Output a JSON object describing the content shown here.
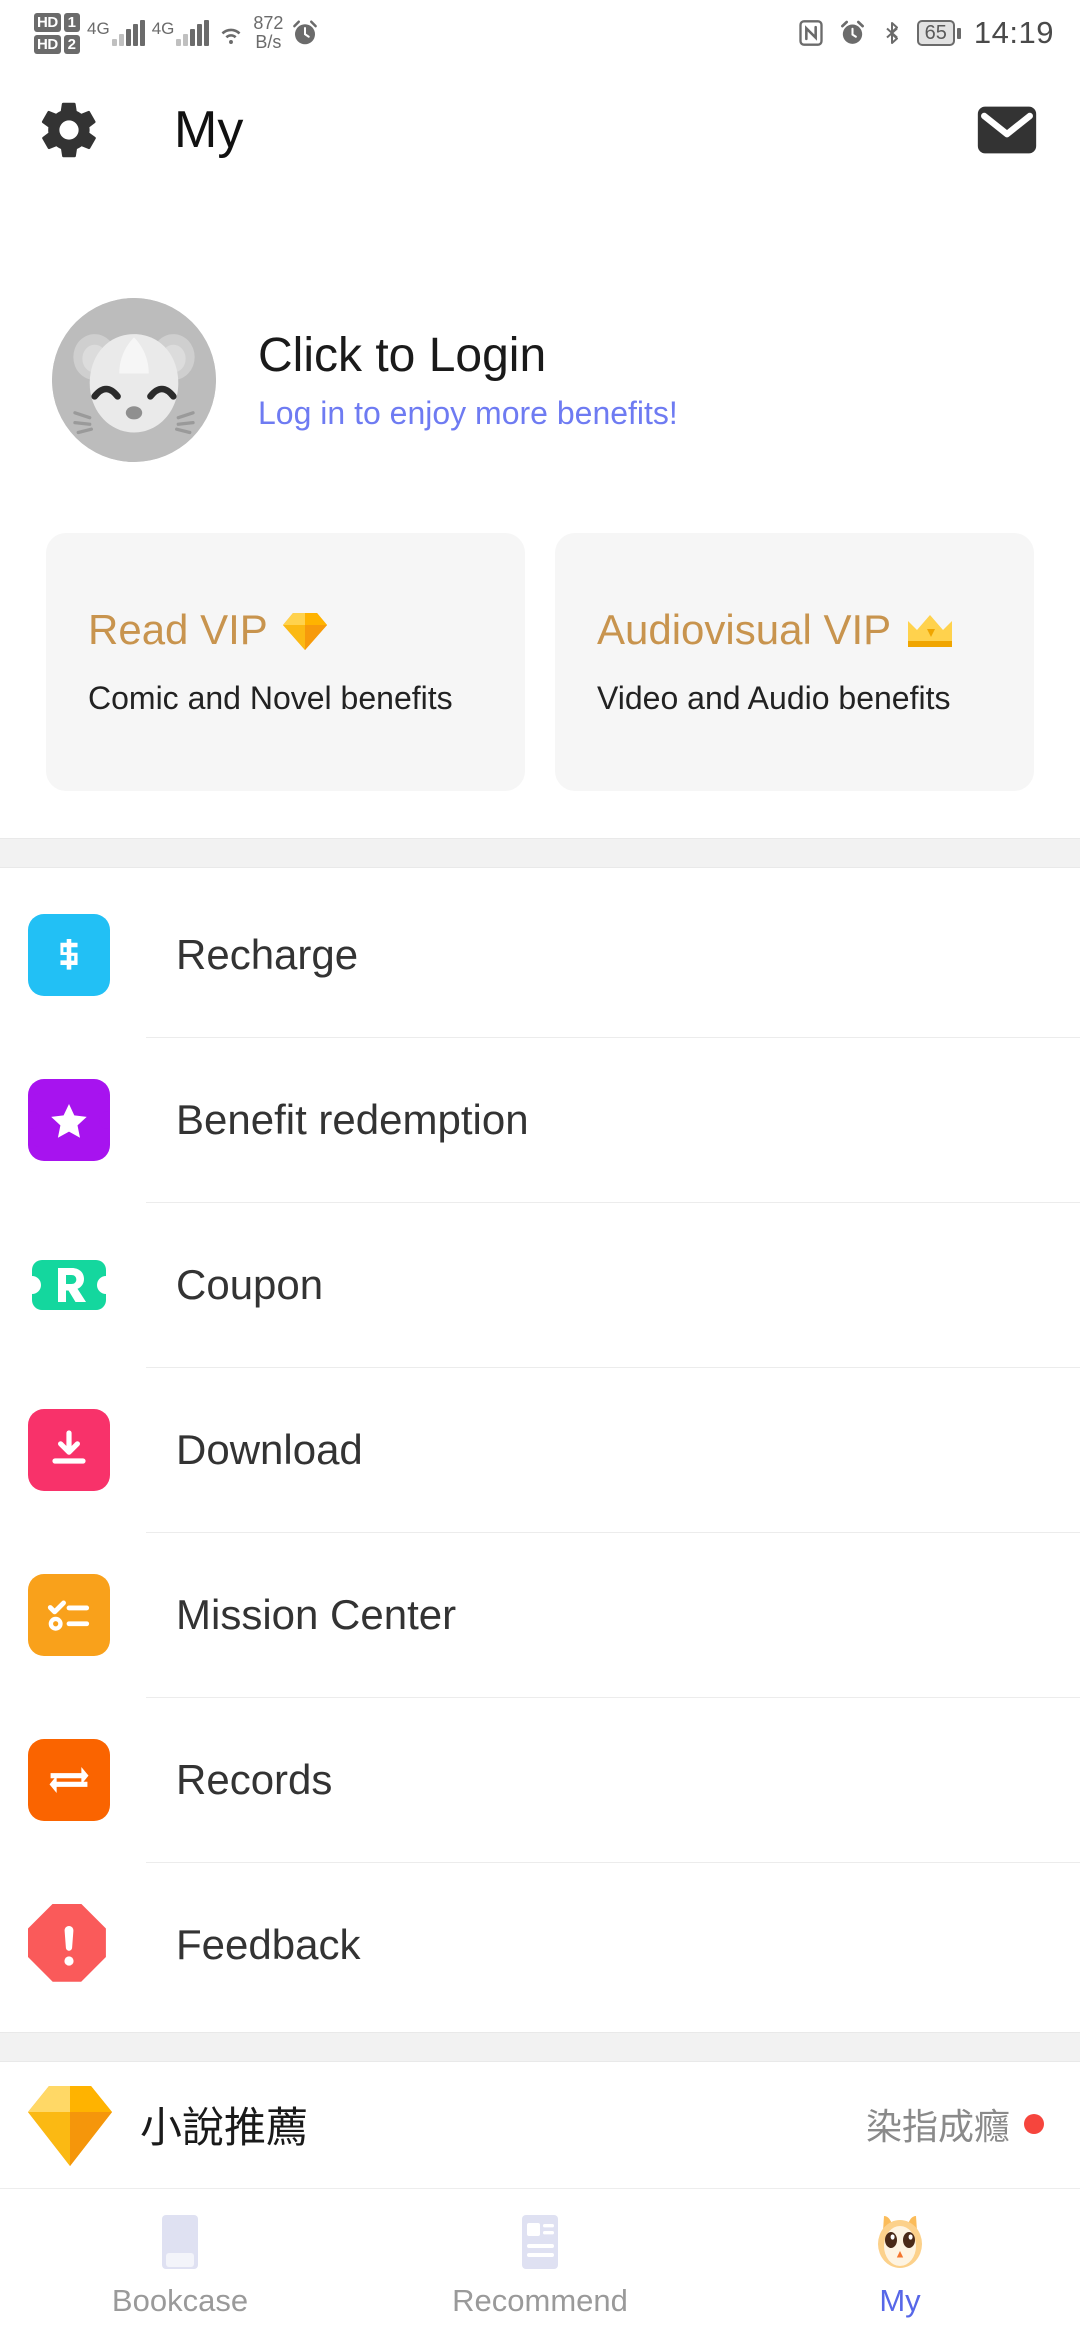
{
  "statusbar": {
    "hd_label_1": "HD",
    "hd_num_1": "1",
    "hd_label_2": "HD",
    "hd_num_2": "2",
    "sim1_network": "4G",
    "sim2_network": "4G",
    "netspeed_value": "872",
    "netspeed_unit": "B/s",
    "icons": [
      "nfc-icon",
      "alarm-icon",
      "bluetooth-icon"
    ],
    "battery_percent": "65",
    "time": "14:19"
  },
  "header": {
    "title": "My",
    "settings_icon": "gear-icon",
    "mail_icon": "mail-icon"
  },
  "profile": {
    "avatar_icon": "hamster-avatar",
    "title": "Click to Login",
    "subtitle": "Log in to enjoy more benefits!",
    "subtitle_color": "#6e7bf2"
  },
  "vip_cards": [
    {
      "title": "Read VIP",
      "emoji_name": "gem-icon",
      "subtitle": "Comic and Novel benefits",
      "title_color": "#c8944e"
    },
    {
      "title": "Audiovisual VIP",
      "emoji_name": "crown-icon",
      "subtitle": "Video and Audio benefits",
      "title_color": "#c8944e"
    }
  ],
  "menu": [
    {
      "label": "Recharge",
      "icon": "dollar-icon",
      "color": "#22c0f5"
    },
    {
      "label": "Benefit redemption",
      "icon": "ticket-star-icon",
      "color": "#a713ef"
    },
    {
      "label": "Coupon",
      "icon": "coupon-r-icon",
      "color": "#14d79e"
    },
    {
      "label": "Download",
      "icon": "download-icon",
      "color": "#f8326a"
    },
    {
      "label": "Mission Center",
      "icon": "checklist-icon",
      "color": "#f9a11b"
    },
    {
      "label": "Records",
      "icon": "exchange-icon",
      "color": "#fa6400"
    },
    {
      "label": "Feedback",
      "icon": "warning-icon",
      "color": "#fa5a5a"
    }
  ],
  "promo": {
    "icon": "gem-icon",
    "title": "小說推薦",
    "subtitle": "染指成癮",
    "badge_color": "#f6453d"
  },
  "tabbar": {
    "tabs": [
      {
        "label": "Bookcase",
        "icon": "book-icon",
        "active": false
      },
      {
        "label": "Recommend",
        "icon": "news-icon",
        "active": false
      },
      {
        "label": "My",
        "icon": "hamster-icon",
        "active": true
      }
    ],
    "active_color": "#5767e8",
    "inactive_color": "#9a9a9a"
  }
}
